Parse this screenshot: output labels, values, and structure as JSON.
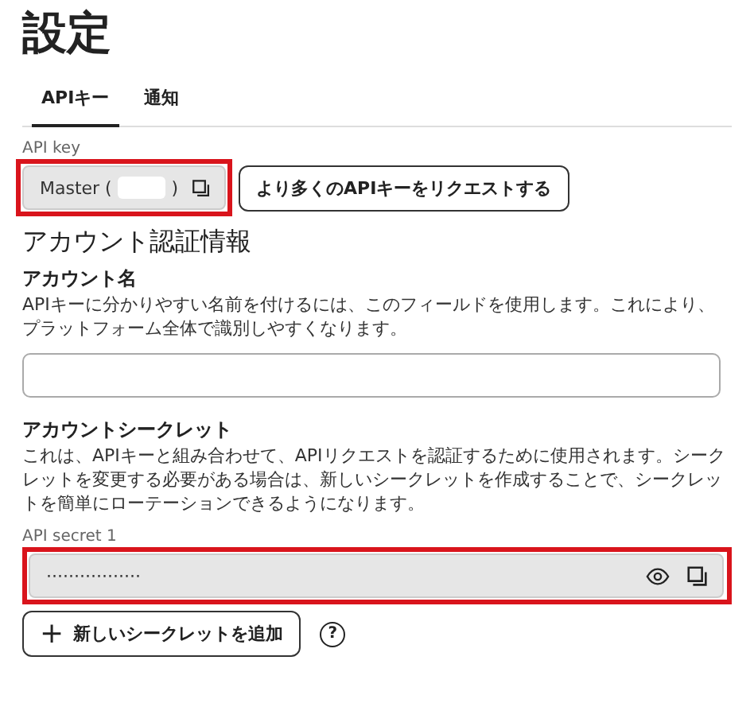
{
  "page_title": "設定",
  "tabs": [
    {
      "label": "APIキー",
      "selected": true
    },
    {
      "label": "通知",
      "selected": false
    }
  ],
  "api_key": {
    "label": "API key",
    "value_prefix": "Master (",
    "value_suffix": ")",
    "highlighted": true
  },
  "request_button": "より多くのAPIキーをリクエストする",
  "section_title": "アカウント認証情報",
  "account_name": {
    "label": "アカウント名",
    "description": "APIキーに分かりやすい名前を付けるには、このフィールドを使用します。これにより、プラットフォーム全体で識別しやすくなります。"
  },
  "account_secret": {
    "label": "アカウントシークレット",
    "description": "これは、APIキーと組み合わせて、APIリクエストを認証するために使用されます。シークレットを変更する必要がある場合は、新しいシークレットを作成することで、シークレットを簡単にローテーションできるようになります。"
  },
  "secret": {
    "label": "API secret 1",
    "value": "·················",
    "highlighted": true
  },
  "add_button": {
    "icon": "+",
    "label": "新しいシークレットを追加"
  },
  "help_icon": "?"
}
